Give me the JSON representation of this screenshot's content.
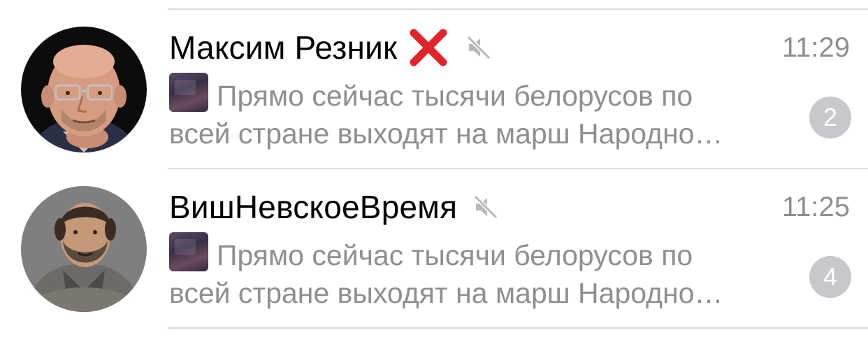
{
  "chats": [
    {
      "name": "Максим Резник",
      "has_cross_emoji": true,
      "muted": true,
      "time": "11:29",
      "preview_line1": "Прямо сейчас тысячи белорусов по",
      "preview_line2": "всей стране выходят на марш Народно…",
      "unread_count": "2",
      "avatar_icon": "person-avatar"
    },
    {
      "name": "ВишНевскоеВремя",
      "has_cross_emoji": false,
      "muted": true,
      "time": "11:25",
      "preview_line1": "Прямо сейчас тысячи белорусов по",
      "preview_line2": "всей стране выходят на марш Народно…",
      "unread_count": "4",
      "avatar_icon": "person-avatar"
    }
  ],
  "colors": {
    "secondary_text": "#8e8e93",
    "badge_muted": "#c7c7cc",
    "divider": "#d9d9de",
    "cross_emoji": "#e0242a"
  }
}
